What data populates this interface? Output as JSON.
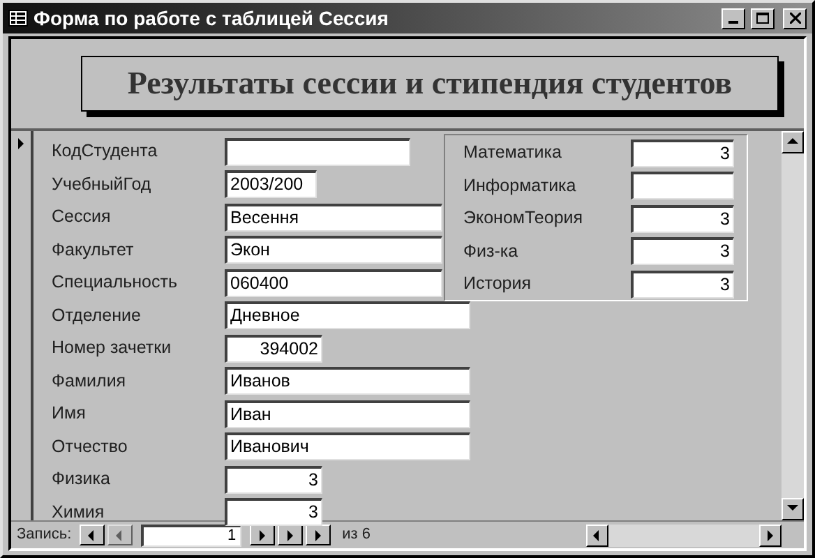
{
  "window": {
    "title": "Форма по работе с таблицей Сессия"
  },
  "header": {
    "title": "Результаты сессии и стипендия студентов"
  },
  "fields": [
    {
      "label": "КодСтудента",
      "kind": "medium"
    },
    {
      "label": "УчебныйГод",
      "value": "2003/200",
      "kind": "short"
    },
    {
      "label": "Сессия",
      "value": "Весення",
      "kind": "covered"
    },
    {
      "label": "Факультет",
      "value": "Экон",
      "kind": "covered"
    },
    {
      "label": "Специальность",
      "value": "060400",
      "kind": "covered"
    },
    {
      "label": "Отделение",
      "value": "Дневное",
      "kind": "wide"
    },
    {
      "label": "Номер зачетки",
      "value": "394002",
      "kind": "number"
    },
    {
      "label": "Фамилия",
      "value": "Иванов",
      "kind": "wide"
    },
    {
      "label": "Имя",
      "value": "Иван",
      "kind": "wide"
    },
    {
      "label": "Отчество",
      "value": "Иванович",
      "kind": "wide"
    },
    {
      "label": "Физика",
      "value": "3",
      "kind": "number"
    },
    {
      "label": "Химия",
      "value": "3",
      "kind": "number"
    }
  ],
  "subform": {
    "fields": [
      {
        "label": "Математика",
        "value": "3"
      },
      {
        "label": "Информатика"
      },
      {
        "label": "ЭкономТеория",
        "value": "3"
      },
      {
        "label": "Физ-ка",
        "value": "3"
      },
      {
        "label": "История",
        "value": "3"
      }
    ]
  },
  "navigation": {
    "label": "Запись:",
    "current": "1",
    "total": "из 6"
  }
}
